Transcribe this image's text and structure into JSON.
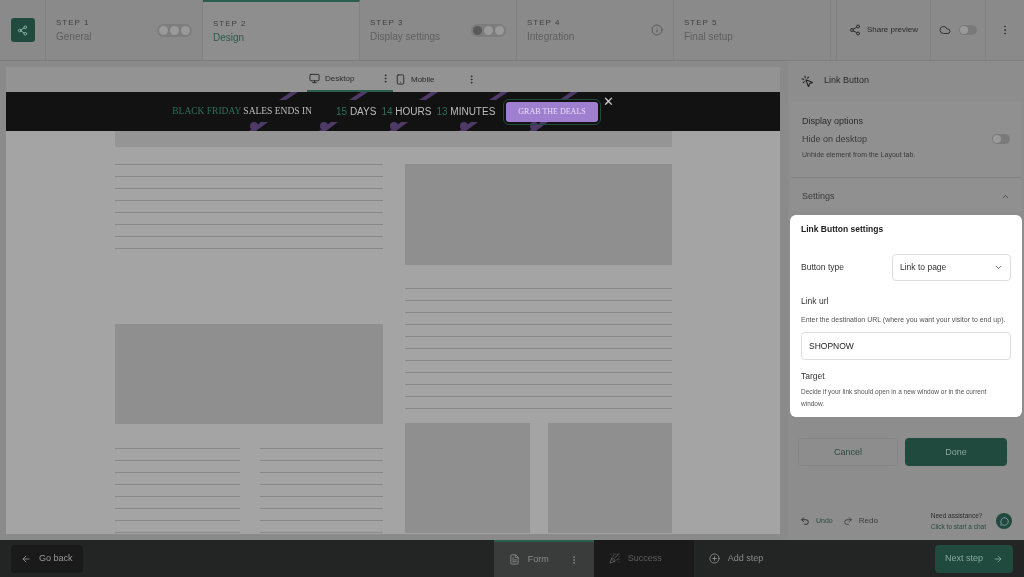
{
  "steps": [
    {
      "number": "STEP 1",
      "title": "General",
      "selected": false,
      "kind": "dots"
    },
    {
      "number": "STEP 2",
      "title": "Design",
      "selected": true,
      "kind": "plain"
    },
    {
      "number": "STEP 3",
      "title": "Display settings",
      "selected": false,
      "kind": "dots"
    },
    {
      "number": "STEP 4",
      "title": "Integration",
      "selected": false,
      "kind": "info"
    },
    {
      "number": "STEP 5",
      "title": "Final setup",
      "selected": false,
      "kind": "plain"
    }
  ],
  "share_button": "Share preview",
  "autosave_toggle": {
    "on": false
  },
  "device_tabs": [
    {
      "label": "Desktop",
      "selected": true
    },
    {
      "label": "Mobile",
      "selected": false
    }
  ],
  "banner": {
    "highlight": "BLACK FRIDAY",
    "text": "SALES ENDS IN",
    "countdown": [
      {
        "value": "15",
        "unit": "DAYS"
      },
      {
        "value": "14",
        "unit": "HOURS"
      },
      {
        "value": "13",
        "unit": "MINUTES"
      }
    ],
    "button": "GRAB THE DEALS",
    "close": "✕"
  },
  "panel": {
    "title": "Link Button",
    "section": "Display options",
    "hide_label": "Hide on desktop",
    "hide_on": false,
    "hide_hint": "Unhide element from the Layout tab.",
    "settings_label": "Settings",
    "settings_expanded": true,
    "popover": {
      "title": "Link Button settings",
      "type_label": "Button type",
      "type_value": "Link to page",
      "url_label": "Link url",
      "url_hint": "Enter the destination URL (where you want your visitor to end up).",
      "url_value": "SHOPNOW",
      "target_label": "Target",
      "target_hint": "Decide if your link should open in a new window or in the current window."
    },
    "cancel": "Cancel",
    "done": "Done",
    "undo": {
      "label": "Undo",
      "disabled": false
    },
    "redo": {
      "label": "Redo",
      "disabled": true
    },
    "help_title": "Need assistance?",
    "help_link": "Click to start a chat"
  },
  "bottom": {
    "back": "Go back",
    "tabs": [
      {
        "label": "Form",
        "selected": true,
        "disabled": false,
        "kind": "form"
      },
      {
        "label": "Success",
        "selected": false,
        "disabled": true,
        "kind": "success"
      },
      {
        "label": "Add step",
        "selected": false,
        "disabled": false,
        "kind": "add"
      }
    ],
    "next": "Next step"
  }
}
